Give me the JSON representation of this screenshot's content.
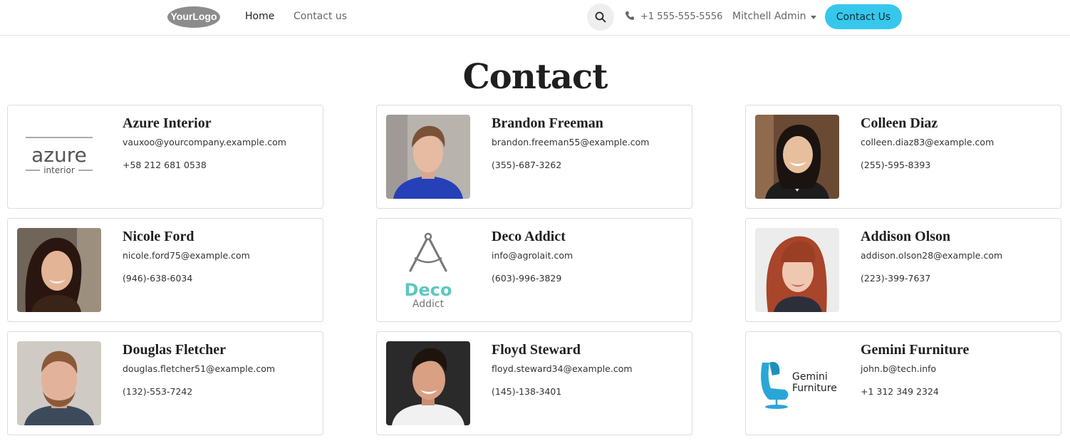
{
  "header": {
    "logo_text": "YourLogo",
    "nav": [
      {
        "label": "Home"
      },
      {
        "label": "Contact us"
      }
    ],
    "phone": "+1 555-555-5556",
    "user": "Mitchell Admin",
    "cta_label": "Contact Us",
    "colors": {
      "cta": "#35c8ec"
    }
  },
  "page": {
    "title": "Contact"
  },
  "contacts": [
    {
      "name": "Azure Interior",
      "email": "vauxoo@yourcompany.example.com",
      "phone": "+58 212 681 0538",
      "avatar": "azure-interior-logo",
      "logo_text": "azure",
      "logo_subtext": "interior"
    },
    {
      "name": "Brandon Freeman",
      "email": "brandon.freeman55@example.com",
      "phone": "(355)-687-3262",
      "avatar": "person-photo"
    },
    {
      "name": "Colleen Diaz",
      "email": "colleen.diaz83@example.com",
      "phone": "(255)-595-8393",
      "avatar": "person-photo"
    },
    {
      "name": "Nicole Ford",
      "email": "nicole.ford75@example.com",
      "phone": "(946)-638-6034",
      "avatar": "person-photo"
    },
    {
      "name": "Deco Addict",
      "email": "info@agrolait.com",
      "phone": "(603)-996-3829",
      "avatar": "deco-addict-logo",
      "logo_text": "Deco",
      "logo_subtext": "Addict"
    },
    {
      "name": "Addison Olson",
      "email": "addison.olson28@example.com",
      "phone": "(223)-399-7637",
      "avatar": "person-photo"
    },
    {
      "name": "Douglas Fletcher",
      "email": "douglas.fletcher51@example.com",
      "phone": "(132)-553-7242",
      "avatar": "person-photo"
    },
    {
      "name": "Floyd Steward",
      "email": "floyd.steward34@example.com",
      "phone": "(145)-138-3401",
      "avatar": "person-photo"
    },
    {
      "name": "Gemini Furniture",
      "email": "john.b@tech.info",
      "phone": "+1 312 349 2324",
      "avatar": "gemini-furniture-logo",
      "logo_text": "Gemini",
      "logo_subtext": "Furniture"
    }
  ]
}
